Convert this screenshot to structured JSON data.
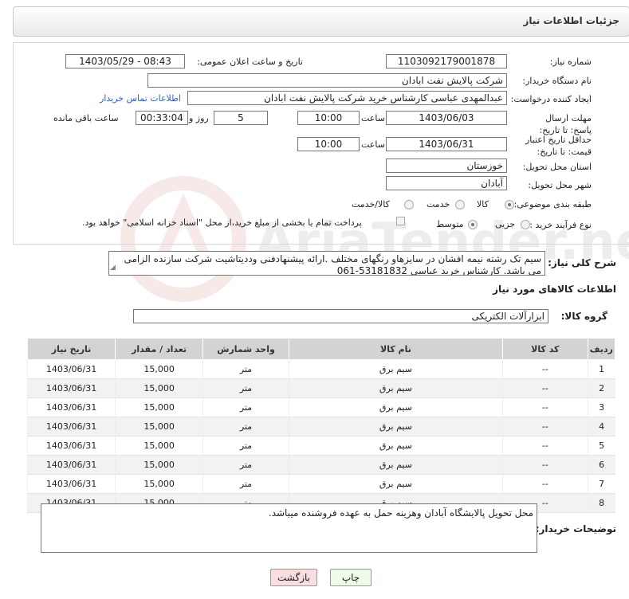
{
  "header": {
    "title": "جزئیات اطلاعات نیاز"
  },
  "fields": {
    "need_number_label": "شماره نیاز:",
    "need_number": "1103092179001878",
    "announce_label": "تاریخ و ساعت اعلان عمومی:",
    "announce_value": "1403/05/29 - 08:43",
    "buyer_label": "نام دستگاه خریدار:",
    "buyer_value": "شرکت پالایش نفت ابادان",
    "creator_label": "ایجاد کننده درخواست:",
    "creator_value": "عبدالمهدی  عباسی کارشناس خرید شرکت پالایش نفت ابادان",
    "contact_link": "اطلاعات تماس خریدار",
    "deadline_label": "مهلت ارسال پاسخ: تا تاریخ:",
    "deadline_date": "1403/06/03",
    "time_label": "ساعت",
    "deadline_time": "10:00",
    "days_value": "5",
    "days_label": "روز و",
    "remaining_time": "00:33:04",
    "remaining_label": "ساعت باقی مانده",
    "min_price_label": "حداقل تاریخ اعتبار قیمت: تا تاریخ:",
    "min_price_date": "1403/06/31",
    "min_price_time": "10:00",
    "province_label": "استان محل تحویل:",
    "province_value": "خوزستان",
    "city_label": "شهر محل تحویل:",
    "city_value": "آبادان",
    "category_label": "طبقه بندی موضوعی:",
    "category_options": [
      "کالا",
      "خدمت",
      "کالا/خدمت"
    ],
    "purchase_label": "نوع فرآیند خرید :",
    "purchase_options": [
      "جزیی",
      "متوسط"
    ],
    "payment_note": "پرداخت تمام یا بخشی از مبلغ خرید،از محل \"اسناد خزانه اسلامی\" خواهد بود."
  },
  "description": {
    "label": "شرح کلی نیاز:",
    "text": "سیم تک رشته نیمه افشان در سایزهاو رنگهای مختلف .ارائه پیشنهادفنی وددیتاشیت شرکت سازنده الزامی می باشد. کارشناس خرید عباسی 53181832-061"
  },
  "goods_section": {
    "title": "اطلاعات کالاهای مورد نیاز",
    "group_label": "گروه کالا:",
    "group_value": "ابزارآلات الکتریکی"
  },
  "table": {
    "headers": [
      "ردیف",
      "کد کالا",
      "نام کالا",
      "واحد شمارش",
      "تعداد / مقدار",
      "تاریخ نیاز"
    ],
    "rows": [
      [
        "1",
        "--",
        "سیم برق",
        "متر",
        "15,000",
        "1403/06/31"
      ],
      [
        "2",
        "--",
        "سیم برق",
        "متر",
        "15,000",
        "1403/06/31"
      ],
      [
        "3",
        "--",
        "سیم برق",
        "متر",
        "15,000",
        "1403/06/31"
      ],
      [
        "4",
        "--",
        "سیم برق",
        "متر",
        "15,000",
        "1403/06/31"
      ],
      [
        "5",
        "--",
        "سیم برق",
        "متر",
        "15,000",
        "1403/06/31"
      ],
      [
        "6",
        "--",
        "سیم برق",
        "متر",
        "15,000",
        "1403/06/31"
      ],
      [
        "7",
        "--",
        "سیم برق",
        "متر",
        "15,000",
        "1403/06/31"
      ],
      [
        "8",
        "--",
        "سیم برق",
        "متر",
        "15,000",
        "1403/06/31"
      ]
    ]
  },
  "buyer_notes": {
    "label": "توضیحات خریدار:",
    "text": "محل تحویل پالایشگاه آبادان وهزینه حمل به عهده فروشنده میباشد."
  },
  "buttons": {
    "print": "چاپ",
    "back": "بازگشت"
  },
  "watermark": {
    "text": "AriaTender.neT"
  },
  "colors": {
    "back_button": "#f8dede",
    "print_button": "#eefbe6",
    "link": "#2a62c9"
  }
}
